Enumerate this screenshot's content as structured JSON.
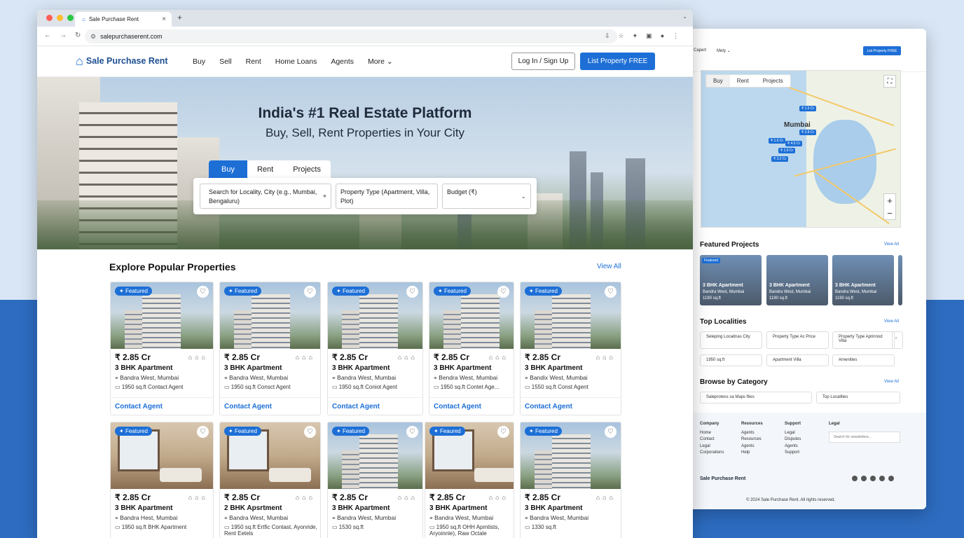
{
  "browser": {
    "tab_title": "Sale Purchase Rent",
    "url": "salepurchaserent.com",
    "new_tab": "+",
    "close": "×"
  },
  "site": {
    "logo": "Sale Purchase Rent",
    "nav": [
      "Buy",
      "Sell",
      "Rent",
      "Home Loans",
      "Agents",
      "More ⌄"
    ],
    "login": "Log In / Sign Up",
    "list_btn": "List Property FREE"
  },
  "hero": {
    "title": "India's #1 Real Estate Platform",
    "subtitle": "Buy, Sell, Rent Properties in Your City",
    "tabs": [
      "Buy",
      "Rent",
      "Projects"
    ],
    "search_placeholder": "Search for Locality, City (e.g., Mumbai, Bengaluru)",
    "property_type": "Property Type (Apartment, Villa, Plot)",
    "budget": "Budget (₹)"
  },
  "explore": {
    "title": "Explore Popular Properties",
    "view_all": "View All"
  },
  "cards": [
    {
      "tag": "Featured",
      "price": "₹ 2.85 Cr",
      "type": "3 BHK Apartment",
      "loc": "Bandra West, Mumbai",
      "meta": "1950 sq.ft   Contact Agent",
      "cta": "Contact Agent",
      "img": "tower"
    },
    {
      "tag": "Featured",
      "price": "₹ 2.85 Cr",
      "type": "3 BHK Apartment",
      "loc": "Bandra West, Mumbai",
      "meta": "1950 sq.ft   Consct Agent",
      "cta": "Contact Agent",
      "img": "tower"
    },
    {
      "tag": "Featured",
      "price": "₹ 2.85 Cr",
      "type": "3 BHK Apartment",
      "loc": "Bandra West, Mumbai",
      "meta": "1950 sq.ft   Coniot Agent",
      "cta": "Contact Agent",
      "img": "tower"
    },
    {
      "tag": "Featured",
      "price": "₹ 2.85 Cr",
      "type": "3 BHK Apartment",
      "loc": "Bendra West, Mumbai",
      "meta": "1950 sq.ft   Contet Age...",
      "cta": "Contact Agent",
      "img": "tower"
    },
    {
      "tag": "Featured",
      "price": "₹ 2.85 Cr",
      "type": "3 BHK Apartment",
      "loc": "Bandix West, Mumbai",
      "meta": "1550 sq.ft   Const Agent",
      "cta": "Contact Agent",
      "img": "tower"
    },
    {
      "tag": "Featured",
      "price": "₹ 2.85 Cr",
      "type": "3 BHK Apartment",
      "loc": "Bandra Hest, Mumbai",
      "meta": "1950 sq.ft   BHK Apartment",
      "cta": "",
      "img": "int"
    },
    {
      "tag": "Featured",
      "price": "₹ 2.85 Cr",
      "type": "2 BHK Apsrtment",
      "loc": "Bandra West, Mumbai",
      "meta": "1950 sq.ft   Ertfic Contast, Ayonride, Rent Eetels",
      "cta": "",
      "img": "int"
    },
    {
      "tag": "Featured",
      "price": "₹ 2.85 Cr",
      "type": "3 BHK Apartment",
      "loc": "Bandra West, Mumbai",
      "meta": "1530 sq.ft",
      "cta": "",
      "img": "tower"
    },
    {
      "tag": "Feaured",
      "price": "₹ 2.85 Cr",
      "type": "3 BHK Apartment",
      "loc": "Bandra West, Mumbai",
      "meta": "1950 sq.ft   OHH Apmtists, Aryoinnle), Raw Octale",
      "cta": "",
      "img": "int"
    },
    {
      "tag": "Featured",
      "price": "₹ 2.85 Cr",
      "type": "3 BHK Apartment",
      "loc": "Bandra West, Mumbai",
      "meta": "1330 sq.ft",
      "cta": "",
      "img": "tower"
    }
  ],
  "side": {
    "top_links": [
      "Capert",
      "Mety ⌄"
    ],
    "top_btn": "List Property FREE",
    "map_tabs": [
      "Buy",
      "Rent",
      "Projects"
    ],
    "map_city": "Mumbai",
    "pins": [
      "₹ 1.5 Cr",
      "₹ 2.8 Cr",
      "₹ 1.6 Cr",
      "₹ 4.5 Cr",
      "₹ 1.9 Cr",
      "₹ 3.2 Cr"
    ],
    "featured_title": "Featured Projects",
    "view_all": "View All",
    "projects": [
      {
        "tag": "Featured",
        "t": "3 BHK Apartment",
        "l": "Bandra West, Mumbai",
        "s": "1190 sq.ft"
      },
      {
        "tag": "",
        "t": "3 BHK Apartment",
        "l": "Bandra West, Mumbai",
        "s": "1190 sq.ft"
      },
      {
        "tag": "",
        "t": "3 BHK Apartment",
        "l": "Bandra West, Mumbai",
        "s": "1190 sq.ft"
      }
    ],
    "localities_title": "Top Localities",
    "localities": [
      "Seleping Locaitnas City",
      "Property Type Ac Price",
      "Property Type Aprinnod Villa"
    ],
    "localities2": [
      "1950 sq.ft",
      "Apartment Villa",
      "Amenities"
    ],
    "category_title": "Browse by Category",
    "categories": [
      "Saleprotess sa Maps fties",
      "Top Localities"
    ],
    "footer_cols": [
      {
        "h": "Company",
        "items": [
          "Home",
          "Contact",
          "Legal",
          "Corporations"
        ]
      },
      {
        "h": "Resources",
        "items": [
          "Agents",
          "Resources",
          "Agents",
          "Help"
        ]
      },
      {
        "h": "Support",
        "items": [
          "Legal",
          "Disputes",
          "Agents",
          "Support"
        ]
      },
      {
        "h": "Legal",
        "items": []
      }
    ],
    "newsletter": "Search for newsletters...",
    "footer_brand": "Sale Purchase Rent",
    "copyright": "© 2024 Sale Purchase Rent. All rights reserved."
  }
}
